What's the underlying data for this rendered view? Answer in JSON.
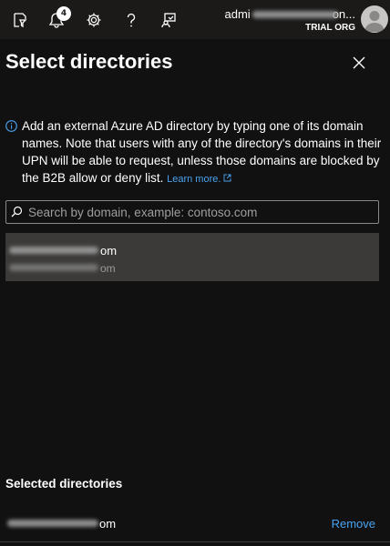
{
  "topbar": {
    "icons": [
      "portal-settings-directory-icon",
      "notifications-bell-icon",
      "settings-gear-icon",
      "help-question-icon",
      "feedback-icon"
    ],
    "notification_count": "4",
    "account_email_start": "admi",
    "account_email_end": "on...",
    "account_org": "TRIAL ORG"
  },
  "panel": {
    "title": "Select directories",
    "info_text": "Add an external Azure AD directory by typing one of its domain names. Note that users with any of the directory's domains in their UPN will be able to request, unless those domains are blocked by the B2B allow or deny list.",
    "learn_more": "Learn more.",
    "search_placeholder": "Search by domain, example: contoso.com",
    "search_value": "",
    "results": [
      {
        "line1_suffix": "om",
        "line2_suffix": "om"
      }
    ],
    "selected_heading": "Selected directories",
    "selected": [
      {
        "domain_suffix": "om",
        "remove_label": "Remove"
      }
    ]
  },
  "colors": {
    "topbar_bg": "#1b1a19",
    "panel_bg": "#111111",
    "accent_link": "#4aa3f0",
    "result_bg": "#3b3a39"
  }
}
